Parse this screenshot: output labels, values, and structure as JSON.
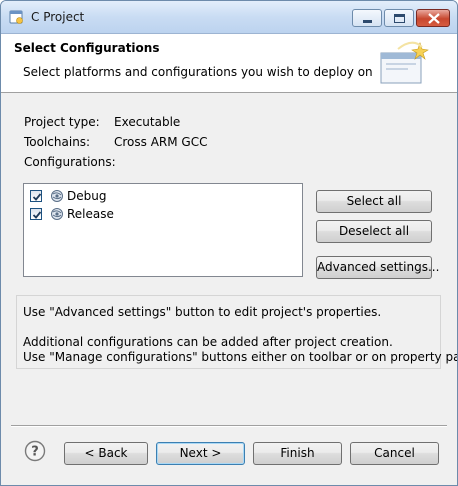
{
  "window": {
    "title": "C Project"
  },
  "header": {
    "title": "Select Configurations",
    "subtitle": "Select platforms and configurations you wish to deploy on"
  },
  "fields": {
    "project_type_label": "Project type:",
    "project_type_value": "Executable",
    "toolchains_label": "Toolchains:",
    "toolchains_value": "Cross ARM GCC",
    "configurations_label": "Configurations:"
  },
  "configurations": [
    {
      "label": "Debug",
      "checked": true
    },
    {
      "label": "Release",
      "checked": true
    }
  ],
  "side_buttons": {
    "select_all": "Select all",
    "deselect_all": "Deselect all",
    "advanced": "Advanced settings..."
  },
  "info": {
    "line1": "Use \"Advanced settings\" button to edit project's properties.",
    "line2": "Additional configurations can be added after project creation.",
    "line3": "Use \"Manage configurations\" buttons either on toolbar or on property pages."
  },
  "footer": {
    "back": "< Back",
    "next": "Next >",
    "finish": "Finish",
    "cancel": "Cancel"
  }
}
